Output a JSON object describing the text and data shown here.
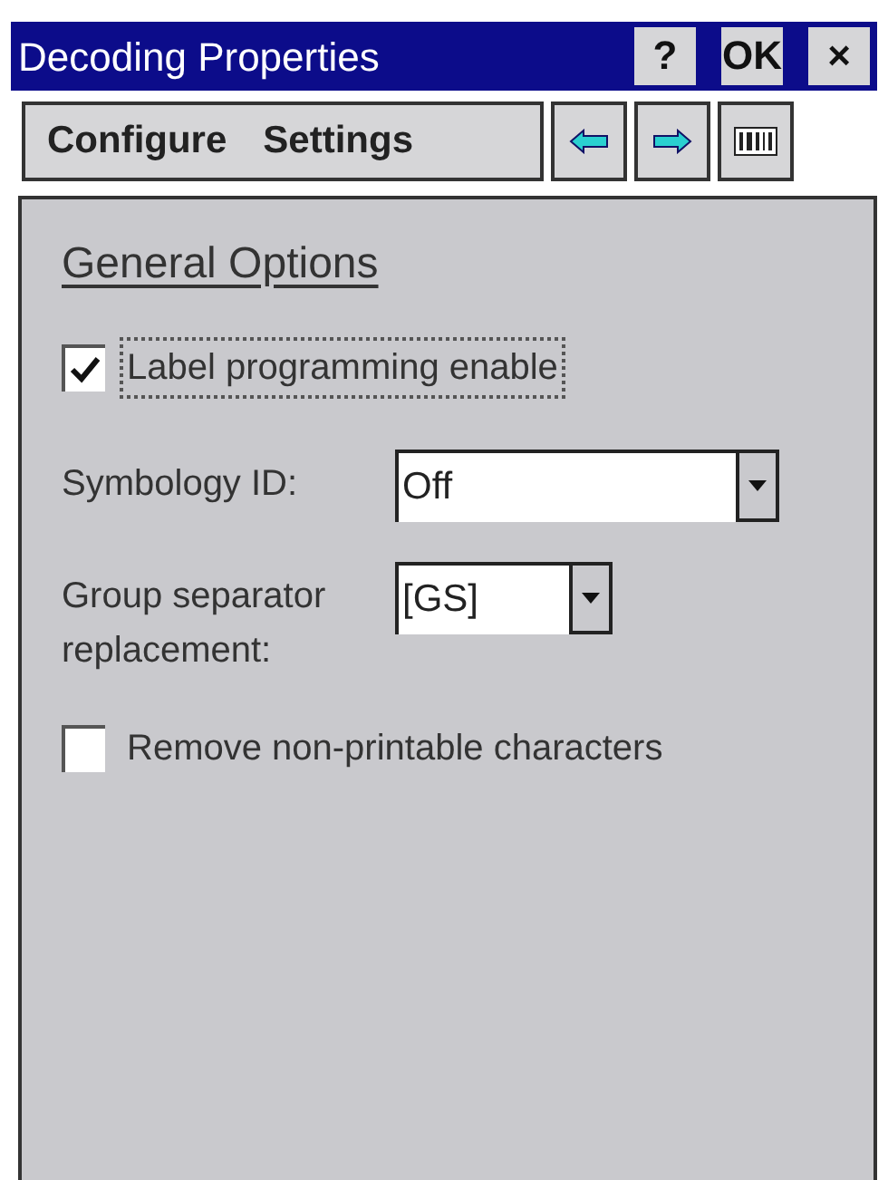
{
  "window": {
    "title": "Decoding Properties",
    "buttons": [
      "?",
      "OK",
      "×"
    ]
  },
  "menu": [
    {
      "label": "Configure"
    },
    {
      "label": "Settings"
    }
  ],
  "toolbar": [
    {
      "kind": "back"
    },
    {
      "kind": "forward"
    },
    {
      "kind": "barcode"
    }
  ],
  "section_title": "General Options",
  "controls": [
    {
      "kind": "checkbox",
      "label": "Label programming enable",
      "checked": true,
      "focused": true
    },
    {
      "kind": "combo",
      "label": "Symbology ID:",
      "value": "Off"
    },
    {
      "kind": "combo",
      "label": "Group separator replacement:",
      "value": "[GS]"
    },
    {
      "kind": "checkbox",
      "label": "Remove non-printable characters",
      "checked": false,
      "focused": false
    }
  ]
}
